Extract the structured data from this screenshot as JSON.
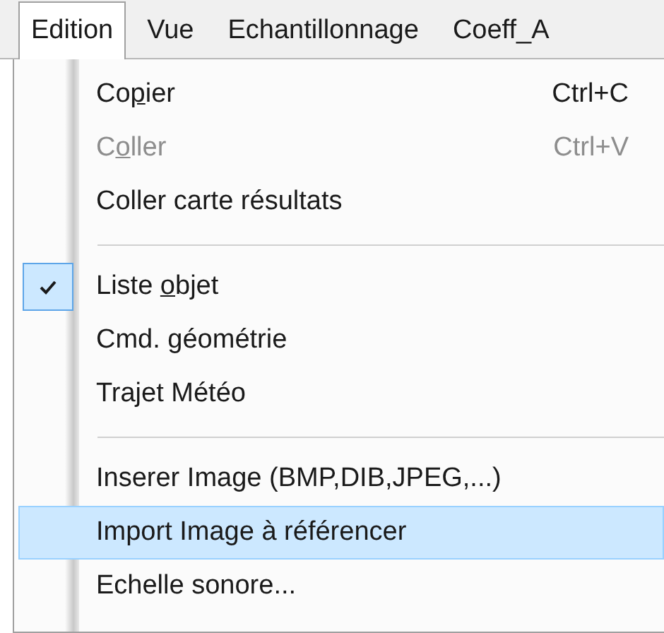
{
  "menubar": [
    {
      "label": "Edition",
      "selected": true
    },
    {
      "label": "Vue",
      "selected": false
    },
    {
      "label": "Echantillonnage",
      "selected": false
    },
    {
      "label": "Coeff_A",
      "selected": false
    }
  ],
  "menu": {
    "items": [
      {
        "kind": "item",
        "label": "Co",
        "mnemonic": "p",
        "label_rest": "ier",
        "shortcut": "Ctrl+C",
        "disabled": false,
        "checked": false,
        "selected": false
      },
      {
        "kind": "item",
        "label": "C",
        "mnemonic": "o",
        "label_rest": "ller",
        "shortcut": "Ctrl+V",
        "disabled": true,
        "checked": false,
        "selected": false
      },
      {
        "kind": "item",
        "label": "Coller carte résultats",
        "disabled": false,
        "checked": false,
        "selected": false
      },
      {
        "kind": "separator"
      },
      {
        "kind": "item",
        "label": "Liste ",
        "mnemonic": "o",
        "label_rest": "bjet",
        "disabled": false,
        "checked": true,
        "selected": false
      },
      {
        "kind": "item",
        "label": "Cmd. géométrie",
        "disabled": false,
        "checked": false,
        "selected": false
      },
      {
        "kind": "item",
        "label": "Trajet Météo",
        "disabled": false,
        "checked": false,
        "selected": false
      },
      {
        "kind": "separator"
      },
      {
        "kind": "item",
        "label": "Inserer Image (BMP,DIB,JPEG,...)",
        "disabled": false,
        "checked": false,
        "selected": false
      },
      {
        "kind": "item",
        "label": "Import Image à référencer",
        "disabled": false,
        "checked": false,
        "selected": true
      },
      {
        "kind": "item",
        "label": "Echelle sonore...",
        "disabled": false,
        "checked": false,
        "selected": false
      }
    ]
  }
}
